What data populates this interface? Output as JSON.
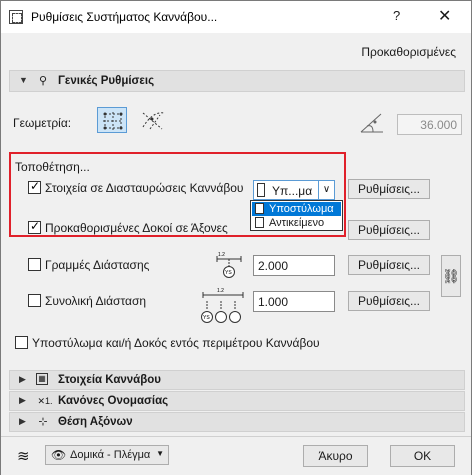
{
  "window": {
    "title": "Ρυθμίσεις Συστήματος Καννάβου...",
    "help_label": "?",
    "close_label": "✕"
  },
  "preset_label": "Προκαθορισμένες",
  "general_panel": {
    "title": "Γενικές Ρυθμίσεις",
    "geometry_label": "Γεωμετρία:",
    "angle_value": "36.000"
  },
  "placement": {
    "title": "Τοποθέτηση...",
    "grid_elements": {
      "label": "Στοιχεία σε Διασταυρώσεις Καννάβου",
      "checked": true,
      "combo_value": "Υπ...μα",
      "settings_label": "Ρυθμίσεις..."
    },
    "dropdown_options": [
      {
        "label": "Υποστύλωμα",
        "selected": true
      },
      {
        "label": "Αντικείμενο",
        "selected": false
      }
    ],
    "default_beams": {
      "label": "Προκαθορισμένες Δοκοί σε Άξονες",
      "checked": true,
      "settings_label": "Ρυθμίσεις..."
    }
  },
  "dimension_lines": {
    "label": "Γραμμές Διάστασης",
    "checked": false,
    "value": "2.000",
    "settings_label": "Ρυθμίσεις...",
    "icon_text": "1.2",
    "icon_badge": "YS"
  },
  "overall_dimension": {
    "label": "Συνολική Διάσταση",
    "checked": false,
    "value": "1.000",
    "settings_label": "Ρυθμίσεις...",
    "icon_text": "1.2",
    "icon_badge": "YS"
  },
  "perimeter_option": {
    "label": "Υποστύλωμα και/ή Δοκός εντός περιμέτρου Καννάβου",
    "checked": false
  },
  "collapsed_panels": [
    {
      "title": "Στοιχεία Καννάβου",
      "icon": "grid-elements-icon"
    },
    {
      "title": "Κανόνες Ονομασίας",
      "icon": "naming-icon"
    },
    {
      "title": "Θέση Αξόνων",
      "icon": "axis-position-icon"
    }
  ],
  "footer": {
    "layer_label": "Δομικά - Πλέγμα",
    "cancel_label": "Άκυρο",
    "ok_label": "ΟΚ"
  },
  "colors": {
    "highlight_red": "#e0202a",
    "selection_blue": "#0078d7"
  }
}
